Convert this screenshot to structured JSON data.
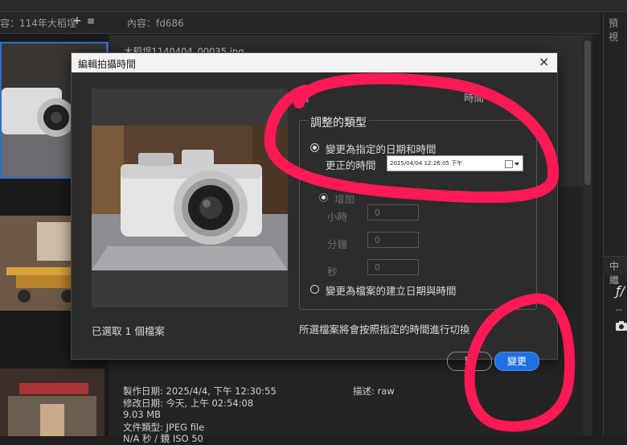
{
  "app": {
    "tab_text": "容：114年大稻埕",
    "tab_plus": "+",
    "tab_menu": "≡",
    "content_label": "內容：fd686",
    "right_label_top": "預視",
    "right_label_mid": "中繼",
    "right_frag": "ƒ/",
    "right_dash": "--"
  },
  "background": {
    "filename": "大稻埕1140404_00035.jpg",
    "meta": {
      "created": "製作日期: 2025/4/4, 下午 12:30:55",
      "description": "描述: raw",
      "modified": "修改日期: 今天, 上午 02:54:08",
      "size": "9.03 MB",
      "file_type": "文件類型: JPEG file",
      "partial": "N/A 秒 / 鏡 ISO 50"
    }
  },
  "dialog": {
    "title": "編輯拍攝時間",
    "close": "×",
    "partial_top": "藉",
    "partial_top_right": "時間",
    "group_title": "調整的類型",
    "option_specified": "變更為指定的日期和時間",
    "corrected_label": "更正的時間",
    "datetime_value": "2025/04/04 12:26:05 下午",
    "option_shift": "增加",
    "hours_label": "小時",
    "minutes_label": "分鐘",
    "seconds_label": "秒",
    "hours_value": "0",
    "minutes_value": "0",
    "seconds_value": "0",
    "option_file_created": "變更為檔案的建立日期與時間",
    "selected_count": "已選取 1 個檔案",
    "hint": "所選檔案將會按照指定的時間進行切換",
    "cancel_label": "取",
    "change_label": "變更"
  },
  "colors": {
    "accent": "#1f6fe0",
    "annotation": "#ff1a55"
  }
}
